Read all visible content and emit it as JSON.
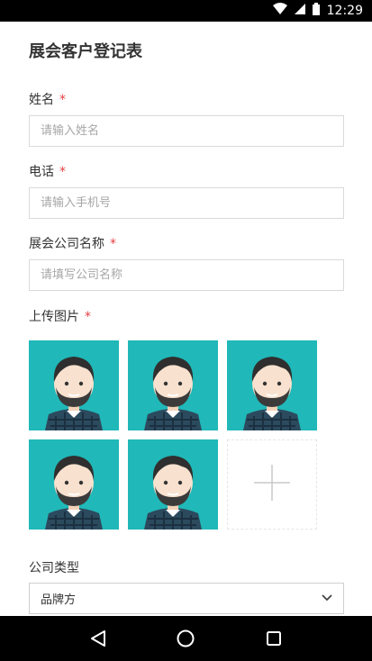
{
  "status_bar": {
    "time": "12:29",
    "icons": [
      "wifi-icon",
      "cellular-signal-icon",
      "battery-icon"
    ]
  },
  "form": {
    "title": "展会客户登记表",
    "required_mark": "*",
    "name": {
      "label": "姓名",
      "placeholder": "请输入姓名"
    },
    "phone": {
      "label": "电话",
      "placeholder": "请输入手机号"
    },
    "company": {
      "label": "展会公司名称",
      "placeholder": "请填写公司名称"
    },
    "upload": {
      "label": "上传图片",
      "photo_count": 5,
      "add_icon": "plus-icon"
    },
    "company_type": {
      "label": "公司类型",
      "selected": "品牌方"
    }
  },
  "nav_bar": {
    "buttons": [
      "back-triangle-icon",
      "home-circle-icon",
      "recents-square-icon"
    ]
  },
  "colors": {
    "required": "#e94040",
    "photo_bg": "#20b8b8",
    "title_text": "#333333",
    "input_border": "#d9d9d9",
    "placeholder": "#a6a6a6"
  }
}
